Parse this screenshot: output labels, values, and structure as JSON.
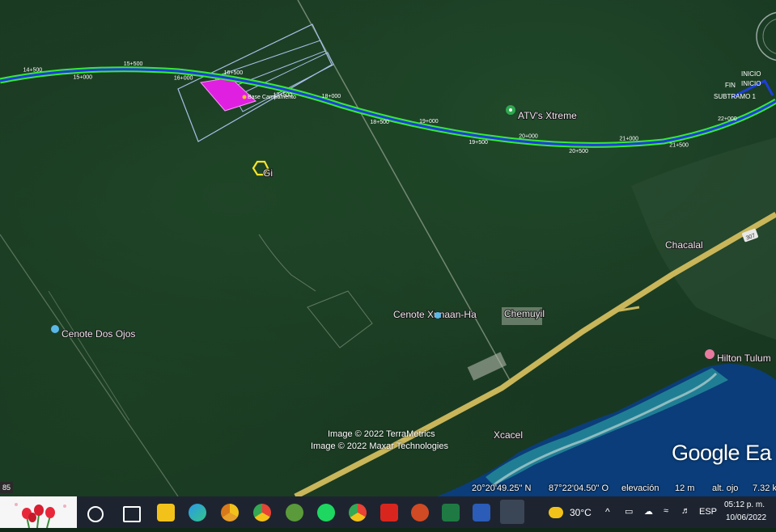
{
  "map": {
    "poi": {
      "atv": "ATV's Xtreme",
      "chacalal": "Chacalal",
      "cenote_xunaan": "Cenote Xunaan-Ha",
      "chemuyil": "Chemuyil",
      "cenote_dos_ojos": "Cenote Dos Ojos",
      "hilton": "Hilton Tulum",
      "xcacel": "Xcacel",
      "gi": "Gi",
      "base": "Base Campamento"
    },
    "km_markers": [
      "14+500",
      "15+000",
      "15+500",
      "16+000",
      "16+500",
      "17+500",
      "18+000",
      "18+500",
      "19+000",
      "19+500",
      "20+000",
      "20+500",
      "21+000",
      "21+500",
      "22+000"
    ],
    "route_labels": {
      "inicio1": "INICIO",
      "inicio2": "INICIO",
      "fin": "FIN",
      "subtramo": "SUBTRAMO 1"
    },
    "highway_shield": "307",
    "credits": {
      "line1": "Image © 2022 TerraMetrics",
      "line2": "Image © 2022 Maxar Technologies"
    },
    "google_logo": "Google Ea",
    "left_tag": "85"
  },
  "status": {
    "lat": "20°20'49.25\" N",
    "lon": "87°22'04.50\" O",
    "elev_label": "elevación",
    "elev_value": "12 m",
    "eye_label": "alt. ojo",
    "eye_value": "7.32 k"
  },
  "taskbar": {
    "temperature": "30°C",
    "language": "ESP",
    "time": "05:12 p. m.",
    "date": "10/06/2022",
    "apps": [
      "start",
      "task-view",
      "file-explorer",
      "edge",
      "chrome-canary",
      "chrome",
      "qgis",
      "spotify",
      "chrome-profile",
      "acrobat",
      "powerpoint",
      "excel",
      "word",
      "google-earth"
    ]
  },
  "colors": {
    "route_green": "#38e838",
    "route_blue": "#1e3ed8",
    "parcel_pink": "#e020e0",
    "highway": "#c9b65a",
    "sea": "#0a3d7a"
  }
}
